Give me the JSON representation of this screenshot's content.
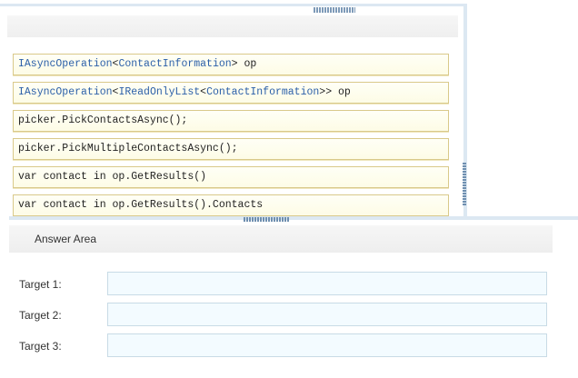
{
  "source_panel": {
    "snippets": [
      {
        "parts": [
          {
            "text": "IAsyncOperation",
            "kind": "type"
          },
          {
            "text": "<",
            "kind": "plain"
          },
          {
            "text": "ContactInformation",
            "kind": "type"
          },
          {
            "text": "> op",
            "kind": "plain"
          }
        ]
      },
      {
        "parts": [
          {
            "text": "IAsyncOperation",
            "kind": "type"
          },
          {
            "text": "<",
            "kind": "plain"
          },
          {
            "text": "IReadOnlyList",
            "kind": "type"
          },
          {
            "text": "<",
            "kind": "plain"
          },
          {
            "text": "ContactInformation",
            "kind": "type"
          },
          {
            "text": ">> op",
            "kind": "plain"
          }
        ]
      },
      {
        "parts": [
          {
            "text": "picker.PickContactsAsync();",
            "kind": "plain"
          }
        ]
      },
      {
        "parts": [
          {
            "text": "picker.PickMultipleContactsAsync();",
            "kind": "plain"
          }
        ]
      },
      {
        "parts": [
          {
            "text": "var contact in op.GetResults()",
            "kind": "plain"
          }
        ]
      },
      {
        "parts": [
          {
            "text": "var contact in op.GetResults().Contacts",
            "kind": "plain"
          }
        ]
      }
    ]
  },
  "answer_area": {
    "title": "Answer Area",
    "targets": [
      {
        "label": "Target 1:"
      },
      {
        "label": "Target 2:"
      },
      {
        "label": "Target 3:"
      }
    ]
  },
  "colors": {
    "type_keyword": "#2b5fa8",
    "snippet_border": "#d9c98a",
    "panel_border": "#dce8f2",
    "target_fill": "#f3fbff"
  }
}
